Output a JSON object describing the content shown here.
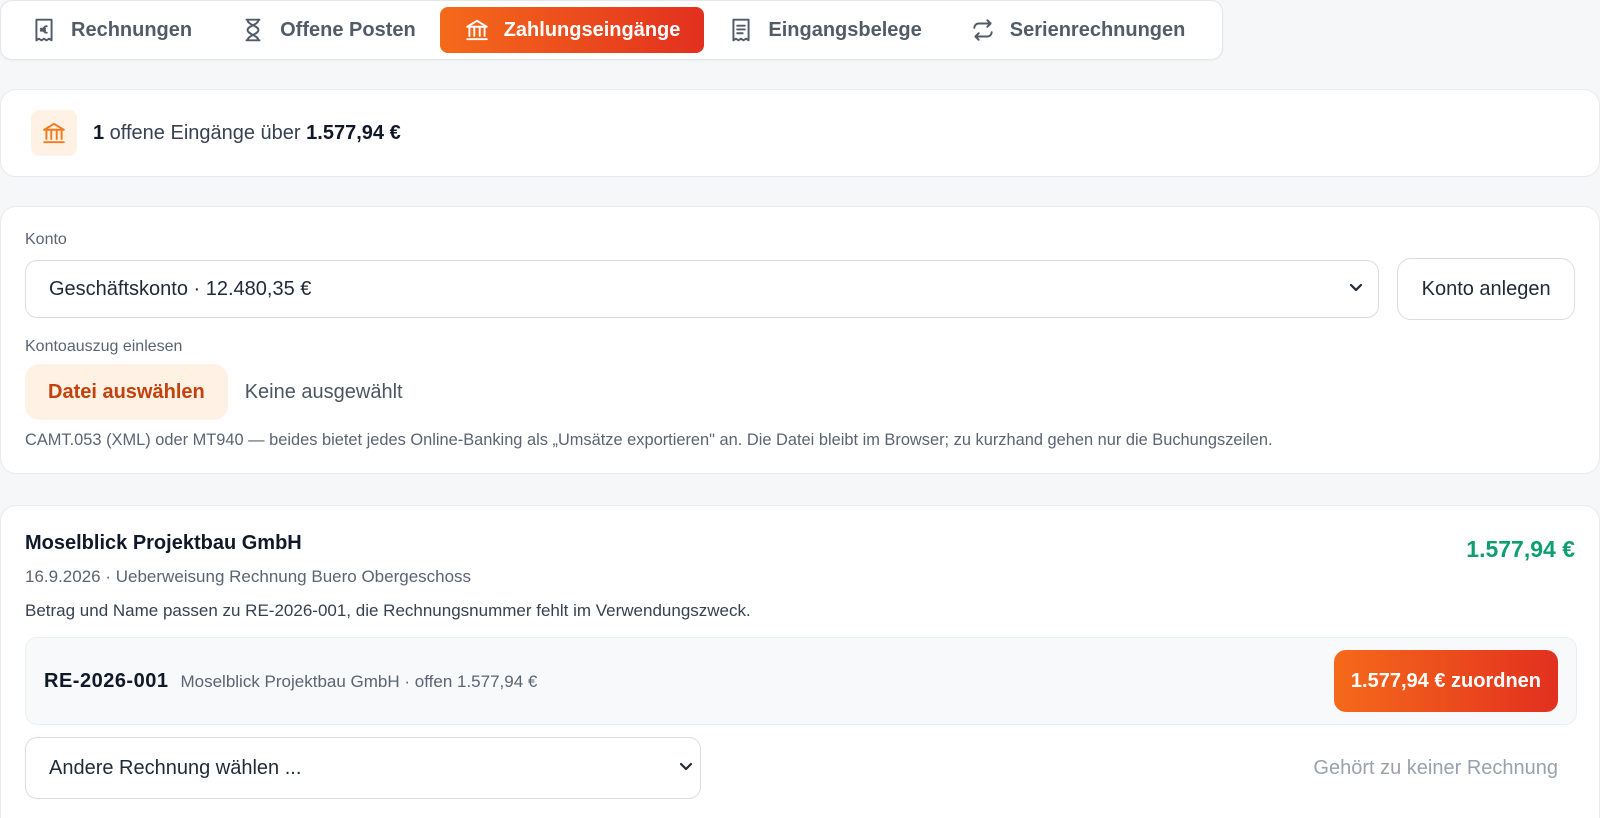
{
  "tabs": [
    {
      "label": "Rechnungen",
      "icon": "receipt-euro-icon",
      "active": false
    },
    {
      "label": "Offene Posten",
      "icon": "hourglass-icon",
      "active": false
    },
    {
      "label": "Zahlungseingänge",
      "icon": "bank-icon",
      "active": true
    },
    {
      "label": "Eingangsbelege",
      "icon": "document-list-icon",
      "active": false
    },
    {
      "label": "Serienrechnungen",
      "icon": "repeat-icon",
      "active": false
    }
  ],
  "summary": {
    "count": "1",
    "middle_text": " offene Eingänge über ",
    "total": "1.577,94 €"
  },
  "account": {
    "label": "Konto",
    "selected": "Geschäftskonto · 12.480,35 €",
    "create_button": "Konto anlegen",
    "statement_label": "Kontoauszug einlesen",
    "file_button": "Datei auswählen",
    "file_status": "Keine ausgewählt",
    "hint": "CAMT.053 (XML) oder MT940 — beides bietet jedes Online-Banking als „Umsätze exportieren\" an. Die Datei bleibt im Browser; zu kurzhand gehen nur die Buchungszeilen."
  },
  "payment": {
    "payer": "Moselblick Projektbau GmbH",
    "amount": "1.577,94 €",
    "meta": "16.9.2026 · Ueberweisung Rechnung Buero Obergeschoss",
    "note": "Betrag und Name passen zu RE-2026-001, die Rechnungsnummer fehlt im Verwendungszweck.",
    "match": {
      "invoice_number": "RE-2026-001",
      "info": "Moselblick Projektbau GmbH · offen 1.577,94 €",
      "assign_button": "1.577,94 € zuordnen"
    },
    "other_invoice_select": "Andere Rechnung wählen ...",
    "no_invoice_link": "Gehört zu keiner Rechnung"
  },
  "colors": {
    "accent_start": "#f56a1a",
    "accent_end": "#e2301f",
    "amount_green": "#0e9f6e",
    "icon_orange": "#f07a1c"
  }
}
